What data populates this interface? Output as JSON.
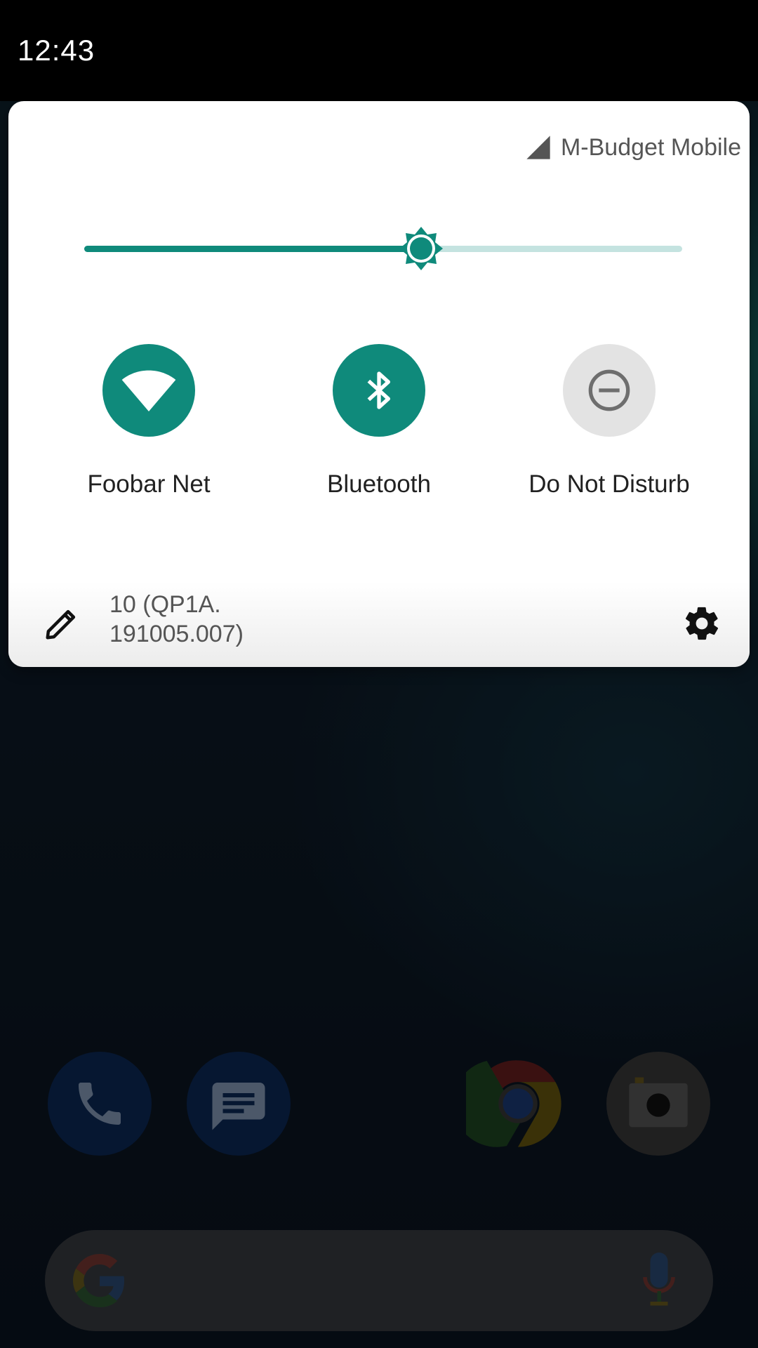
{
  "status_bar": {
    "time": "12:43"
  },
  "quick_settings": {
    "carrier": "M-Budget Mobile",
    "brightness_level": 0.563,
    "tiles": [
      {
        "label": "Foobar Net",
        "icon": "wifi-icon",
        "state": "on"
      },
      {
        "label": "Bluetooth",
        "icon": "bluetooth-icon",
        "state": "on"
      },
      {
        "label": "Do Not Disturb",
        "icon": "do-not-disturb-icon",
        "state": "off"
      }
    ],
    "build_line1": "10 (QP1A.",
    "build_line2": "191005.007)"
  },
  "dock": [
    "phone-app-icon",
    "messages-app-icon",
    "chrome-app-icon",
    "camera-app-icon"
  ],
  "colors": {
    "accent": "#0f8a7b",
    "accent_light": "#c4e3e0",
    "tile_off": "#e3e3e3"
  }
}
